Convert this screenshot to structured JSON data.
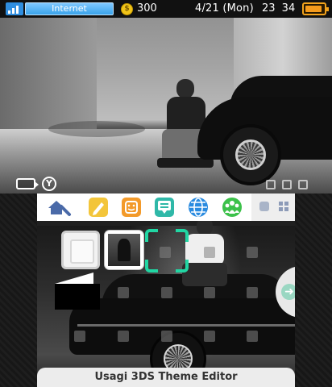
{
  "top_screen": {
    "status": {
      "network_label": "Internet",
      "coin_symbol": "$",
      "coins": "300",
      "date": "4/21 (Mon)",
      "time": "23 34"
    },
    "bottom_left_icons": [
      "camera-icon",
      "y-button-icon"
    ],
    "bottom_right_icons": [
      "square-icon",
      "square-icon",
      "square-icon"
    ]
  },
  "bottom_screen": {
    "toolbar": {
      "home_icon": "home-settings-icon",
      "apps": [
        "notes-pencil-icon",
        "friends-face-icon",
        "notifications-chat-icon",
        "internet-globe-icon",
        "miiverse-people-icon"
      ],
      "right_icons": [
        "single-view-icon",
        "grid-view-icon"
      ]
    },
    "slots": [
      "empty-slot",
      "photo-slot"
    ],
    "next_arrow_icon": "arrow-right-icon",
    "footer_label": "Usagi 3DS Theme Editor"
  },
  "colors": {
    "accent": "#21d6a3",
    "network_blue": "#3aa3ea",
    "battery_orange": "#f59b1c",
    "coin_gold": "#f0c419"
  }
}
